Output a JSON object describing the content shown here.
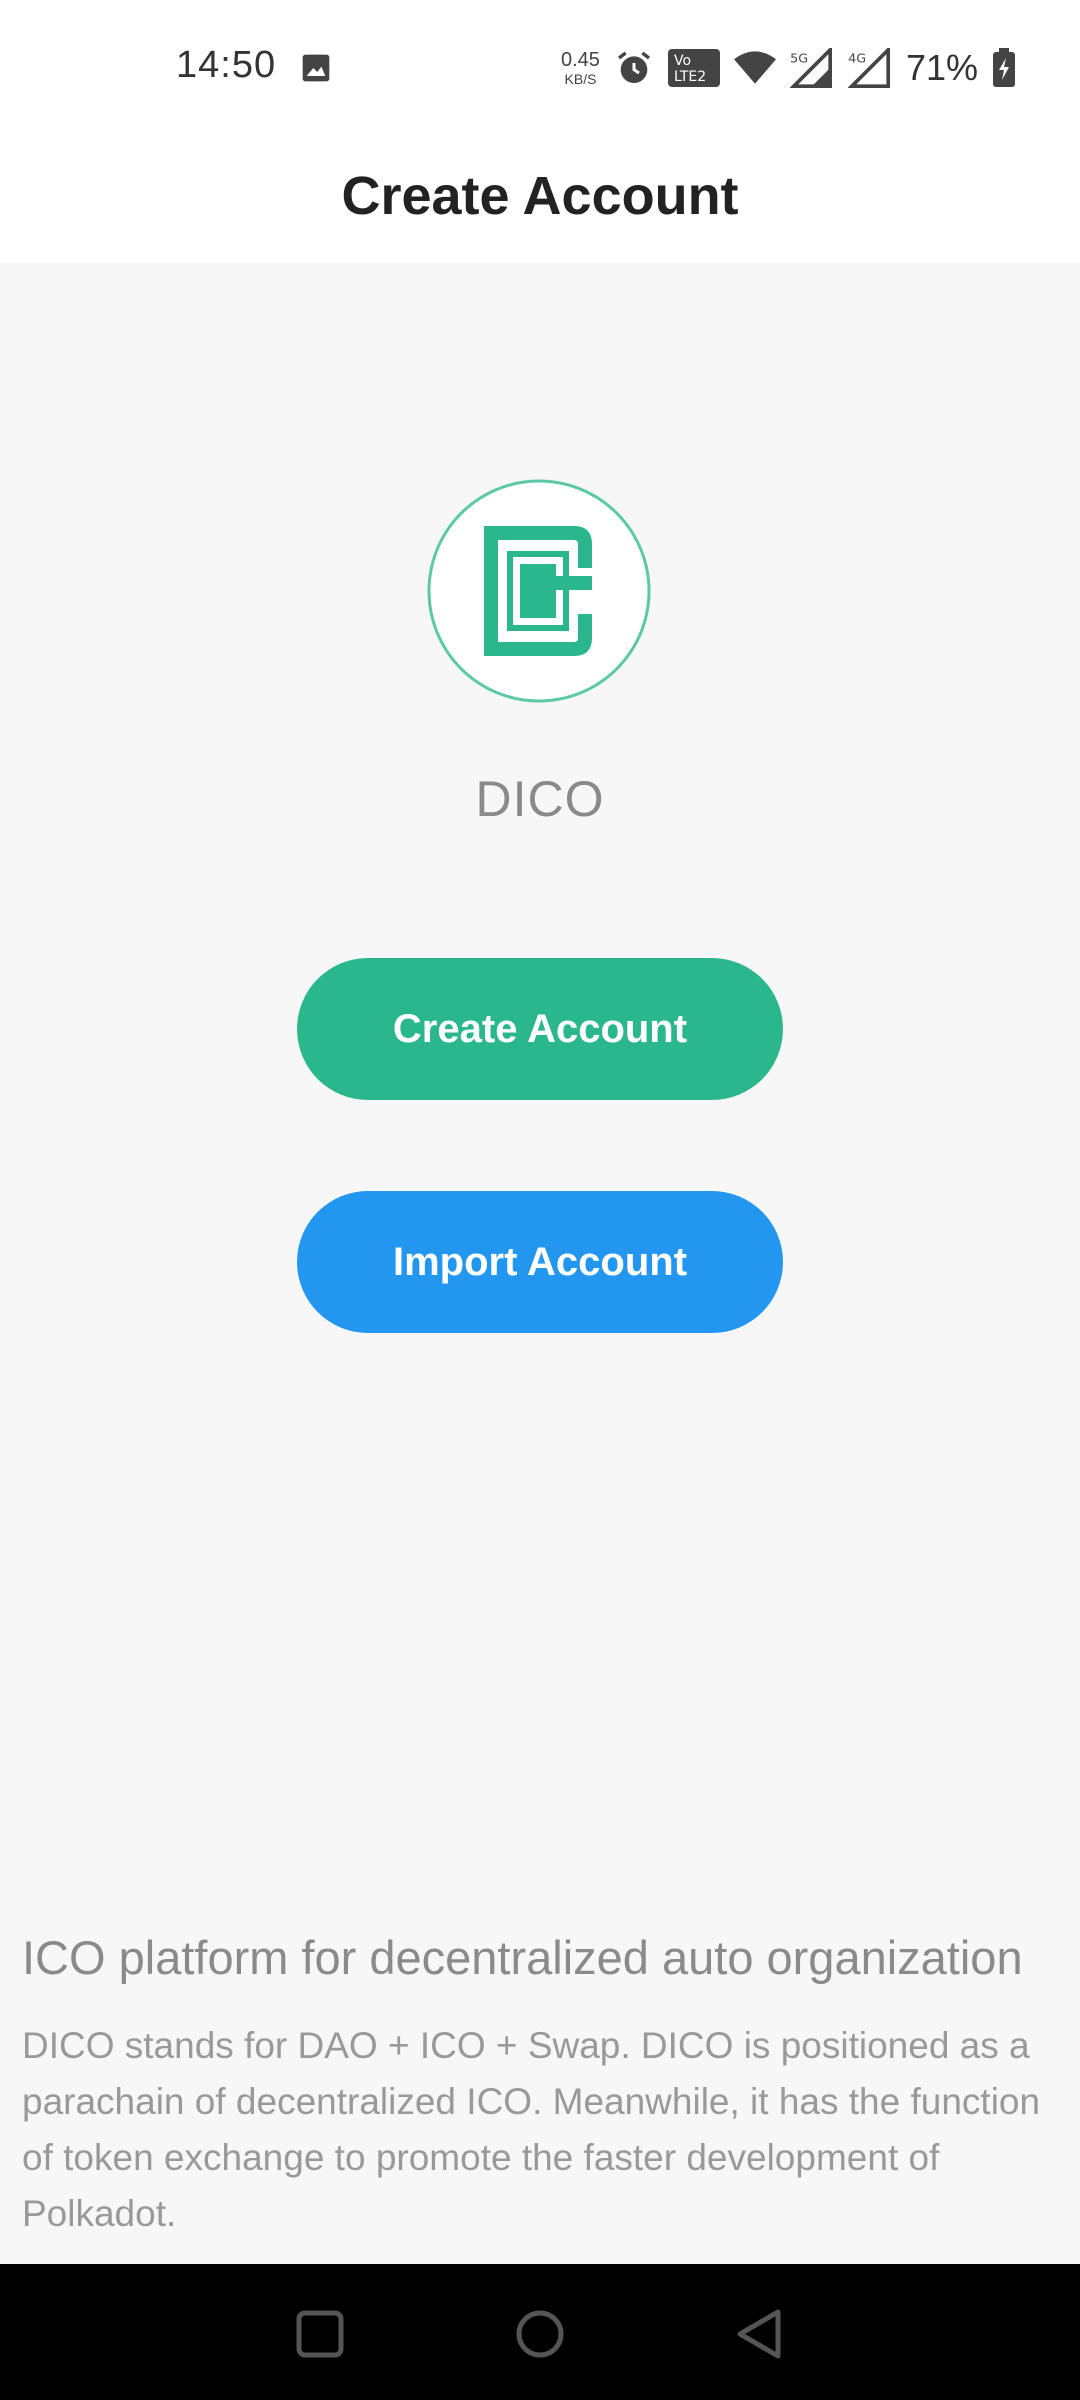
{
  "status_bar": {
    "time": "14:50",
    "net_speed": "0.45",
    "net_unit": "KB/S",
    "battery": "71%",
    "icons": [
      "gallery-icon",
      "alarm-icon",
      "volte-icon",
      "wifi-icon",
      "signal-5g-icon",
      "signal-4g-icon",
      "battery-charging-icon"
    ]
  },
  "header": {
    "title": "Create Account"
  },
  "logo": {
    "name": "dico-logo-icon",
    "color": "#2bb78d"
  },
  "app_name": "DICO",
  "buttons": {
    "create": "Create Account",
    "import": "Import Account"
  },
  "description": {
    "title": "ICO platform for decentralized auto organization",
    "body": "DICO stands for DAO + ICO + Swap. DICO is positioned as a parachain of decentralized ICO. Meanwhile, it has the function of token exchange to promote the faster development of Polkadot."
  },
  "nav": {
    "icons": [
      "recent-apps-icon",
      "home-icon",
      "back-icon"
    ]
  },
  "colors": {
    "primary_green": "#2bb78d",
    "primary_blue": "#2396f0",
    "background": "#f7f7f7"
  }
}
